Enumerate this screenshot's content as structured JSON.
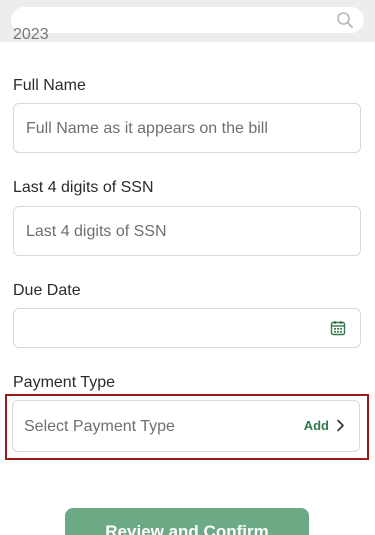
{
  "header": {
    "search_icon": "search-icon"
  },
  "clipped_text": "2023",
  "form": {
    "full_name": {
      "label": "Full Name",
      "placeholder": "Full Name as it appears on the bill"
    },
    "ssn": {
      "label": "Last 4 digits of SSN",
      "placeholder": "Last 4 digits of SSN"
    },
    "due_date": {
      "label": "Due Date",
      "icon": "calendar-icon"
    },
    "payment_type": {
      "label": "Payment Type",
      "placeholder": "Select Payment Type",
      "action": "Add"
    }
  },
  "cta": {
    "label": "Review and Confirm"
  },
  "colors": {
    "accent_green": "#2f7a4e",
    "button_green": "#6ca985",
    "highlight_red": "#9b1a1a"
  }
}
